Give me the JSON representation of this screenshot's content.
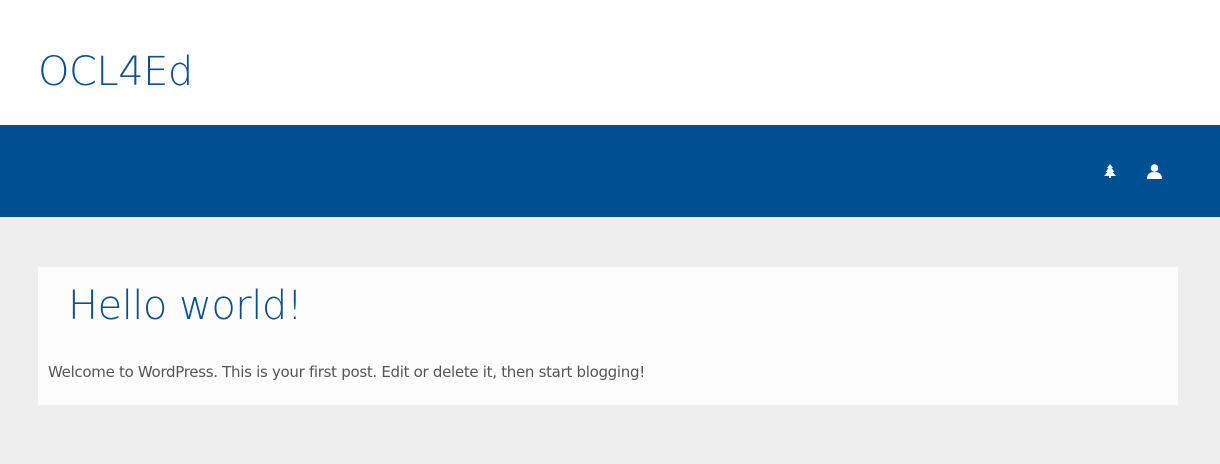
{
  "header": {
    "site_title": "OCL4Ed"
  },
  "nav": {
    "icons": [
      "tree-icon",
      "user-icon"
    ]
  },
  "post": {
    "title": "Hello world!",
    "body": "Welcome to WordPress. This is your first post. Edit or delete it, then start blogging!"
  },
  "colors": {
    "brand_blue": "#004f93",
    "title_blue": "#0b4f92",
    "page_background": "#eeeeee",
    "card_background": "#fdfdfd",
    "body_text": "#555555"
  }
}
